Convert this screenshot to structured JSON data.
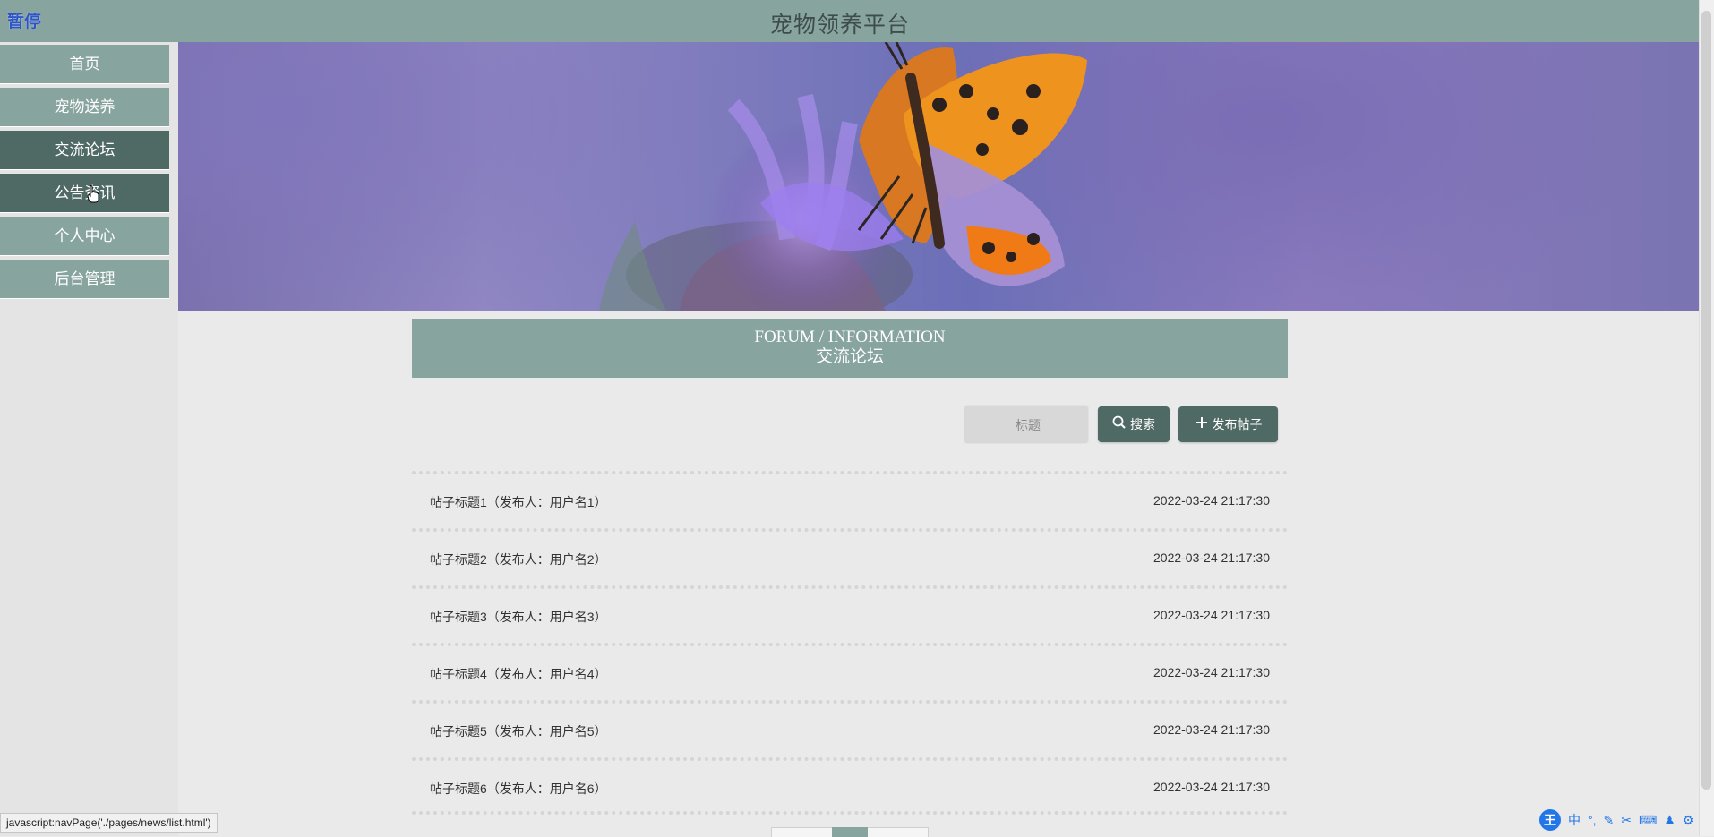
{
  "topbar": {
    "pause_label": "暂停",
    "title": "宠物领养平台"
  },
  "sidebar": {
    "items": [
      {
        "label": "首页",
        "style": "light"
      },
      {
        "label": "宠物送养",
        "style": "light"
      },
      {
        "label": "交流论坛",
        "style": "dark"
      },
      {
        "label": "公告资讯",
        "style": "dark"
      },
      {
        "label": "个人中心",
        "style": "light"
      },
      {
        "label": "后台管理",
        "style": "light"
      }
    ]
  },
  "forum": {
    "title_en": "FORUM / INFORMATION",
    "title_cn": "交流论坛",
    "search_placeholder": "标题",
    "search_label": "搜索",
    "post_label": "发布帖子",
    "posts": [
      {
        "title": "帖子标题1（发布人：用户名1）",
        "time": "2022-03-24 21:17:30"
      },
      {
        "title": "帖子标题2（发布人：用户名2）",
        "time": "2022-03-24 21:17:30"
      },
      {
        "title": "帖子标题3（发布人：用户名3）",
        "time": "2022-03-24 21:17:30"
      },
      {
        "title": "帖子标题4（发布人：用户名4）",
        "time": "2022-03-24 21:17:30"
      },
      {
        "title": "帖子标题5（发布人：用户名5）",
        "time": "2022-03-24 21:17:30"
      },
      {
        "title": "帖子标题6（发布人：用户名6）",
        "time": "2022-03-24 21:17:30"
      }
    ]
  },
  "statusbar": {
    "url": "javascript:navPage('./pages/news/list.html')"
  },
  "ime": {
    "wang": "王",
    "mode": "中"
  },
  "colors": {
    "accent": "#88a49f",
    "dark_accent": "#4f6964",
    "background": "#eaeaea"
  },
  "icons": [
    "butterfly-banner",
    "search-icon",
    "plus-icon",
    "hand-cursor-icon"
  ]
}
